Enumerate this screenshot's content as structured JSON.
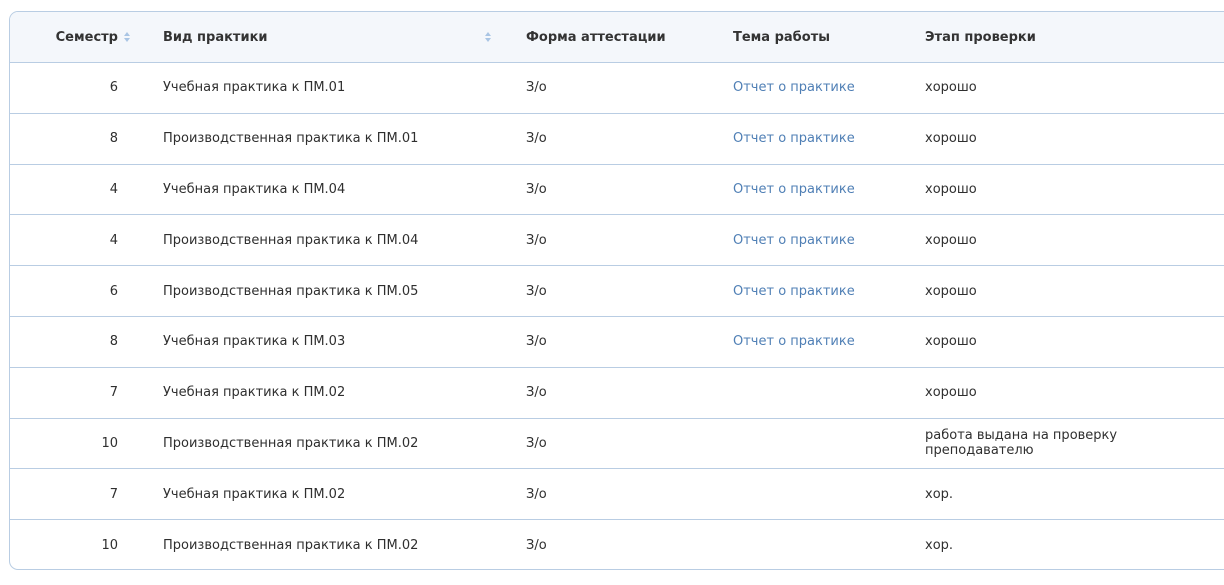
{
  "table": {
    "columns": {
      "semester": "Семестр",
      "practice_type": "Вид практики",
      "attestation_form": "Форма аттестации",
      "work_topic": "Тема работы",
      "review_stage": "Этап проверки"
    },
    "rows": [
      {
        "semester": "6",
        "practice_type": "Учебная практика к ПМ.01",
        "attestation_form": "З/о",
        "work_topic": "Отчет о практике",
        "review_stage": "хорошо"
      },
      {
        "semester": "8",
        "practice_type": "Производственная практика к ПМ.01",
        "attestation_form": "З/о",
        "work_topic": "Отчет о практике",
        "review_stage": "хорошо"
      },
      {
        "semester": "4",
        "practice_type": "Учебная практика к ПМ.04",
        "attestation_form": "З/о",
        "work_topic": "Отчет о практике",
        "review_stage": "хорошо"
      },
      {
        "semester": "4",
        "practice_type": "Производственная практика к ПМ.04",
        "attestation_form": "З/о",
        "work_topic": "Отчет о практике",
        "review_stage": "хорошо"
      },
      {
        "semester": "6",
        "practice_type": "Производственная практика к ПМ.05",
        "attestation_form": "З/о",
        "work_topic": "Отчет о практике",
        "review_stage": "хорошо"
      },
      {
        "semester": "8",
        "practice_type": "Учебная практика к ПМ.03",
        "attestation_form": "З/о",
        "work_topic": "Отчет о практике",
        "review_stage": "хорошо"
      },
      {
        "semester": "7",
        "practice_type": "Учебная практика к ПМ.02",
        "attestation_form": "З/о",
        "work_topic": "",
        "review_stage": "хорошо"
      },
      {
        "semester": "10",
        "practice_type": "Производственная практика к ПМ.02",
        "attestation_form": "З/о",
        "work_topic": "",
        "review_stage": "работа выдана на проверку преподавателю"
      },
      {
        "semester": "7",
        "practice_type": "Учебная практика к ПМ.02",
        "attestation_form": "З/о",
        "work_topic": "",
        "review_stage": "хор."
      },
      {
        "semester": "10",
        "practice_type": "Производственная практика к ПМ.02",
        "attestation_form": "З/о",
        "work_topic": "",
        "review_stage": "хор."
      }
    ]
  },
  "colors": {
    "link": "#4f7fb5",
    "border": "#b9cde3",
    "header_bg": "#f4f7fb",
    "sort_icon": "#a9c5e4"
  },
  "icons": {
    "semester_sort": "sort-icon",
    "practice_type_sort": "sort-icon"
  }
}
